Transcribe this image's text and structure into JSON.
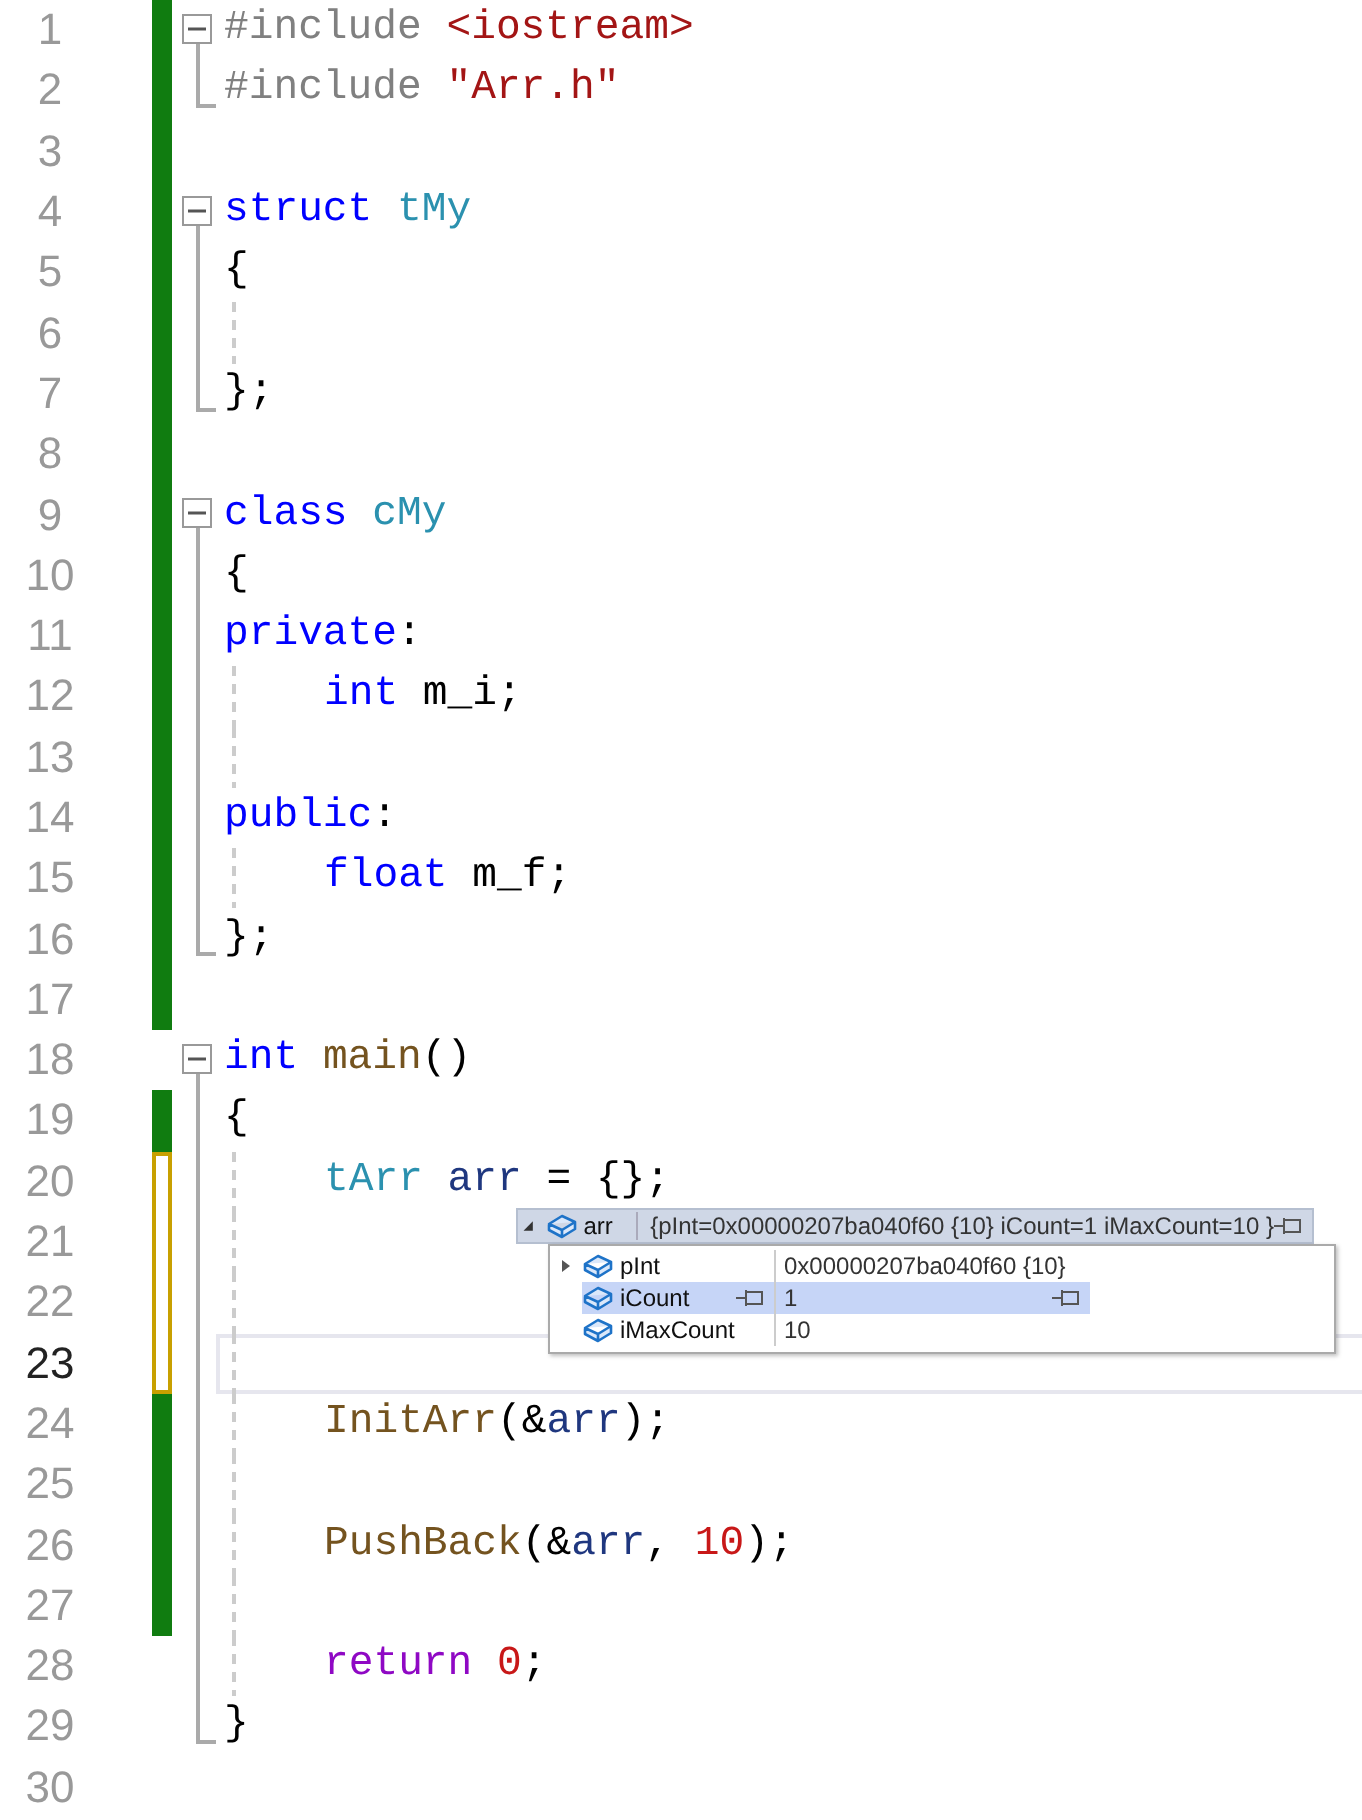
{
  "editor": {
    "lines": [
      {
        "number": "1",
        "saved": true,
        "fold_start": true,
        "expanded": true,
        "tokens": [
          {
            "kind": "preproc",
            "text": "#include "
          },
          {
            "kind": "string",
            "text": "<iostream>"
          }
        ]
      },
      {
        "number": "2",
        "saved": true,
        "fold_end": true,
        "tokens": [
          {
            "kind": "preproc",
            "text": "#include "
          },
          {
            "kind": "string",
            "text": "\"Arr.h\""
          }
        ]
      },
      {
        "number": "3",
        "saved": true
      },
      {
        "number": "4",
        "saved": true,
        "fold_start": true,
        "expanded": true,
        "tokens": [
          {
            "kind": "keyword",
            "text": "struct "
          },
          {
            "kind": "type",
            "text": "tMy"
          }
        ]
      },
      {
        "number": "5",
        "saved": true,
        "fold_line": true,
        "tokens": [
          {
            "kind": "plain",
            "text": "{"
          }
        ]
      },
      {
        "number": "6",
        "saved": true,
        "fold_line": true,
        "guide": true
      },
      {
        "number": "7",
        "saved": true,
        "fold_end": true,
        "tokens": [
          {
            "kind": "plain",
            "text": "};"
          }
        ]
      },
      {
        "number": "8",
        "saved": true
      },
      {
        "number": "9",
        "saved": true,
        "fold_start": true,
        "expanded": true,
        "tokens": [
          {
            "kind": "keyword",
            "text": "class "
          },
          {
            "kind": "type",
            "text": "cMy"
          }
        ]
      },
      {
        "number": "10",
        "saved": true,
        "fold_line": true,
        "tokens": [
          {
            "kind": "plain",
            "text": "{"
          }
        ]
      },
      {
        "number": "11",
        "saved": true,
        "fold_line": true,
        "tokens": [
          {
            "kind": "keyword",
            "text": "private"
          },
          {
            "kind": "plain",
            "text": ":"
          }
        ]
      },
      {
        "number": "12",
        "saved": true,
        "fold_line": true,
        "guide": true,
        "indented": true,
        "tokens": [
          {
            "kind": "keyword",
            "text": "int"
          },
          {
            "kind": "plain",
            "text": " m_i;"
          }
        ]
      },
      {
        "number": "13",
        "saved": true,
        "fold_line": true,
        "guide": true
      },
      {
        "number": "14",
        "saved": true,
        "fold_line": true,
        "tokens": [
          {
            "kind": "keyword",
            "text": "public"
          },
          {
            "kind": "plain",
            "text": ":"
          }
        ]
      },
      {
        "number": "15",
        "saved": true,
        "fold_line": true,
        "guide": true,
        "indented": true,
        "tokens": [
          {
            "kind": "keyword",
            "text": "float"
          },
          {
            "kind": "plain",
            "text": " m_f;"
          }
        ]
      },
      {
        "number": "16",
        "saved": true,
        "fold_end": true,
        "tokens": [
          {
            "kind": "plain",
            "text": "};"
          }
        ]
      },
      {
        "number": "17",
        "saved": true
      },
      {
        "number": "18",
        "fold_start": true,
        "expanded": true,
        "tokens": [
          {
            "kind": "keyword",
            "text": "int "
          },
          {
            "kind": "function",
            "text": "main"
          },
          {
            "kind": "plain",
            "text": "()"
          }
        ]
      },
      {
        "number": "19",
        "saved": true,
        "fold_line": true,
        "tokens": [
          {
            "kind": "plain",
            "text": "{"
          }
        ]
      },
      {
        "number": "20",
        "modified": true,
        "fold_line": true,
        "guide": true,
        "indented": true,
        "tokens": [
          {
            "kind": "type",
            "text": "tArr "
          },
          {
            "kind": "local",
            "text": "arr"
          },
          {
            "kind": "plain",
            "text": " = {};"
          }
        ]
      },
      {
        "number": "21",
        "modified": true,
        "fold_line": true,
        "guide": true
      },
      {
        "number": "22",
        "modified": true,
        "fold_line": true,
        "guide": true
      },
      {
        "number": "23",
        "modified": true,
        "fold_line": true,
        "guide": true,
        "current": true
      },
      {
        "number": "24",
        "saved": true,
        "fold_line": true,
        "guide": true,
        "indented": true,
        "tokens": [
          {
            "kind": "function",
            "text": "InitArr"
          },
          {
            "kind": "plain",
            "text": "(&"
          },
          {
            "kind": "local",
            "text": "arr"
          },
          {
            "kind": "plain",
            "text": ");"
          }
        ]
      },
      {
        "number": "25",
        "saved": true,
        "fold_line": true,
        "guide": true
      },
      {
        "number": "26",
        "saved": true,
        "fold_line": true,
        "guide": true,
        "indented": true,
        "tokens": [
          {
            "kind": "function",
            "text": "PushBack"
          },
          {
            "kind": "plain",
            "text": "(&"
          },
          {
            "kind": "local",
            "text": "arr"
          },
          {
            "kind": "plain",
            "text": ", "
          },
          {
            "kind": "number",
            "text": "10"
          },
          {
            "kind": "plain",
            "text": ");"
          }
        ]
      },
      {
        "number": "27",
        "saved": true,
        "fold_line": true,
        "guide": true
      },
      {
        "number": "28",
        "fold_line": true,
        "guide": true,
        "indented": true,
        "tokens": [
          {
            "kind": "control",
            "text": "return "
          },
          {
            "kind": "number",
            "text": "0"
          },
          {
            "kind": "plain",
            "text": ";"
          }
        ]
      },
      {
        "number": "29",
        "fold_end": true,
        "tokens": [
          {
            "kind": "plain",
            "text": "}"
          }
        ]
      },
      {
        "number": "30"
      }
    ]
  },
  "datatip": {
    "name": "arr",
    "value": "{pInt=0x00000207ba040f60 {10} iCount=1 iMaxCount=10 }",
    "expanded": true,
    "members": [
      {
        "name": "pInt",
        "value": "0x00000207ba040f60 {10}",
        "expandable": true,
        "selected": false
      },
      {
        "name": "iCount",
        "value": "1",
        "expandable": false,
        "selected": true
      },
      {
        "name": "iMaxCount",
        "value": "10",
        "expandable": false,
        "selected": false
      }
    ]
  }
}
